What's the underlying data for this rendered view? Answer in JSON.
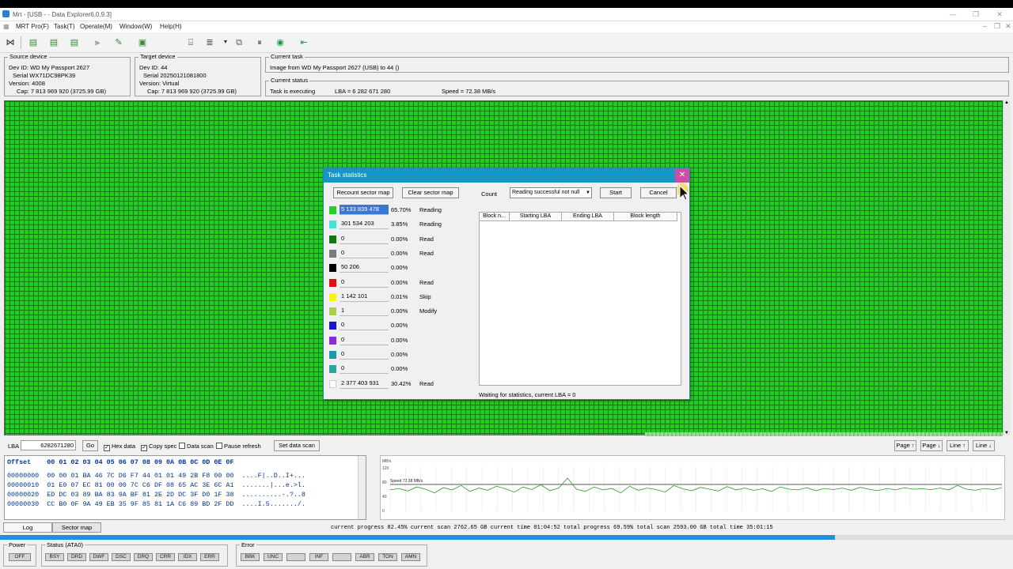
{
  "title_bar": {
    "title": "Mrt - [USB - - Data Explorer6.0.9.3]",
    "minimize": "—",
    "restore": "❐",
    "close": "✕"
  },
  "menu": {
    "items": [
      "MRT Pro(F)",
      "Task(T)",
      "Operate(M)",
      "Window(W)",
      "Help(H)"
    ],
    "mdi": [
      "–",
      "❐",
      "✕"
    ]
  },
  "source": {
    "label": "Source device",
    "dev_id": "Dev ID:  WD My Passport 2627",
    "serial": "Serial  WX71DC98PK39",
    "version": "Version:  4008",
    "cap": "Cap:  7 813 969 920 (3725.99 GB)"
  },
  "target": {
    "label": "Target device",
    "dev_id": "Dev ID:  44",
    "serial": "Serial  2025012108180​0",
    "version": "Version:  Virtual",
    "cap": "Cap:  7 813 969 920 (3725.99 GB)"
  },
  "current_task": {
    "label": "Current task",
    "text": "Image from WD My Passport 2627 (USB) to 44 ()"
  },
  "current_status": {
    "label": "Current status",
    "state": "Task is executing",
    "lba": "LBA = 6 282 671 280",
    "speed": "Speed = 72.38 MB/s"
  },
  "lba_bar": {
    "label": "LBA",
    "value": "6282671280",
    "go": "Go",
    "hex_data": "Hex data",
    "copy_spec": "Copy spec",
    "data_scan": "Data scan",
    "pause_refresh": "Pause refresh",
    "set_data_scan": "Set data scan",
    "page_up": "Page ↑",
    "page_down": "Page ↓",
    "line_up": "Line ↑",
    "line_down": "Line ↓"
  },
  "hex": {
    "header": "Offset    00 01 02 03 04 05 06 07 08 09 0A 0B 0C 0D 0E 0F",
    "rows": [
      "00000000  00 00 01 BA 46 7C D6 F7 44 01 01 49 2B F8 00 00  ....F|..D..I+...",
      "00000010  01 E0 07 EC 81 00 00 7C C6 DF 08 65 AC 3E 6C A1  .......|...e.>l.",
      "00000020  ED DC 03 89 BA 83 9A BF 81 2E 2D DC 3F D0 1F 38  ..........-.?..8",
      "00000030  CC B0 0F 9A 49 EB 35 9F 85 81 1A C6 89 BD 2F DD  ....I.5......./."
    ]
  },
  "chart": {
    "y_unit": "MB/s",
    "y_ticks": [
      "120",
      "80",
      "40",
      "0"
    ],
    "speed_label": "Speed 72.38 MB/s"
  },
  "chart_data": {
    "type": "line",
    "title": "",
    "ylabel": "MB/s",
    "ylim": [
      0,
      120
    ],
    "series": [
      {
        "name": "Speed 72.38 MB/s",
        "values": [
          58,
          62,
          55,
          66,
          60,
          50,
          64,
          58,
          70,
          54,
          63,
          57,
          68,
          61,
          52,
          66,
          59,
          72,
          56,
          63,
          90,
          60,
          54,
          66,
          58,
          62,
          50,
          68,
          57,
          63,
          59,
          52,
          70,
          61,
          56,
          65,
          60,
          55,
          67,
          58,
          63,
          57,
          61,
          54,
          66,
          60,
          58,
          64,
          56,
          62,
          59,
          63,
          57,
          65,
          60,
          56,
          62,
          58,
          64,
          60,
          61,
          59,
          63,
          58,
          70,
          60,
          57,
          62,
          59,
          64
        ]
      }
    ]
  },
  "tabs": {
    "log": "Log",
    "sector_map": "Sector map"
  },
  "progress_text": "current progress 82.45%  current scan  2762.65 GB  current time  01:04:52  total progress 69.59%  total scan 2593.00 GB  total time  35:01:15",
  "progress_fraction": 0.8245,
  "status": {
    "power_label": "Power",
    "power": "OFF",
    "status_label": "Status (ATA0)",
    "flags": [
      "BSY",
      "DRD",
      "DWF",
      "DSC",
      "DRQ",
      "CRR",
      "IDX",
      "ERR"
    ],
    "error_label": "Error",
    "errors": [
      "BBK",
      "UNC",
      "",
      "INF",
      "",
      "ABR",
      "TON",
      "AMN"
    ]
  },
  "dialog": {
    "title": "Task statistics",
    "close": "✕",
    "recount": "Recount sector map",
    "clear": "Clear sector map",
    "count_label": "Count",
    "count_select": "Reading successful not null",
    "start": "Start",
    "cancel": "Cancel",
    "rows": [
      {
        "color": "#21d321",
        "value": "5 133 839 478",
        "pct": "65.70%",
        "label": "Reading"
      },
      {
        "color": "#3fe3d8",
        "value": "301 534 203",
        "pct": "3.85%",
        "label": "Reading"
      },
      {
        "color": "#127a12",
        "value": "0",
        "pct": "0.00%",
        "label": "Read"
      },
      {
        "color": "#7a7a7a",
        "value": "0",
        "pct": "0.00%",
        "label": "Read"
      },
      {
        "color": "#000000",
        "value": "50 206",
        "pct": "0.00%",
        "label": ""
      },
      {
        "color": "#e01010",
        "value": "0",
        "pct": "0.00%",
        "label": "Read"
      },
      {
        "color": "#f7f70f",
        "value": "1 142 101",
        "pct": "0.01%",
        "label": "Skip"
      },
      {
        "color": "#a8d04a",
        "value": "1",
        "pct": "0.00%",
        "label": "Modify"
      },
      {
        "color": "#1616c8",
        "value": "0",
        "pct": "0.00%",
        "label": ""
      },
      {
        "color": "#8a2be2",
        "value": "0",
        "pct": "0.00%",
        "label": ""
      },
      {
        "color": "#1a9aa8",
        "value": "0",
        "pct": "0.00%",
        "label": ""
      },
      {
        "color": "#2aa8a0",
        "value": "0",
        "pct": "0.00%",
        "label": ""
      },
      {
        "color": "#ffffff",
        "value": "2 377 403 931",
        "pct": "30.42%",
        "label": "Read"
      }
    ],
    "table_headers": [
      "Block n...",
      "Starting LBA",
      "Ending LBA",
      "Block length"
    ],
    "footer": "Waiting for statistics, current LBA = 0"
  },
  "colors": {
    "sector_green": "#1fcf1f",
    "dialog_title": "#1596c4",
    "progress": "#1f8fde"
  }
}
